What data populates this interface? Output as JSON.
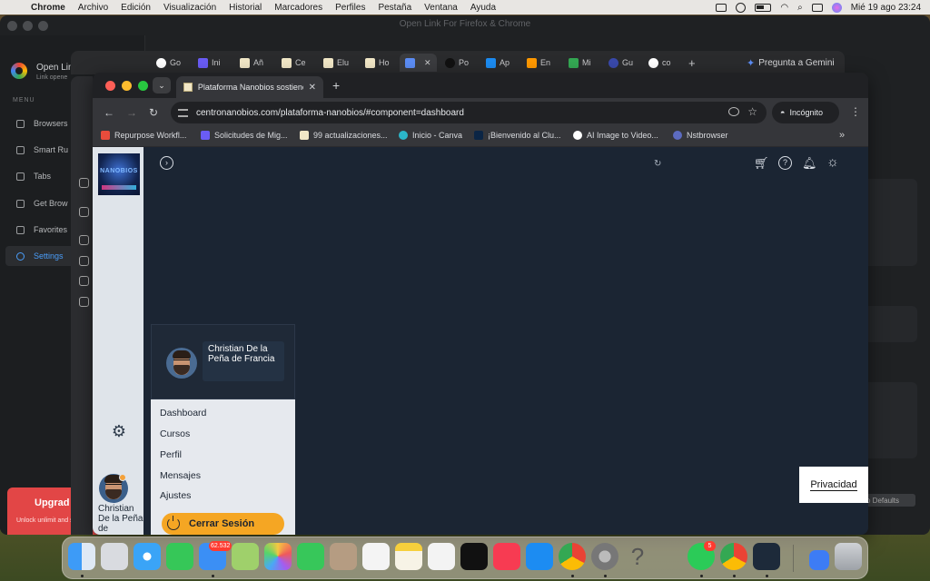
{
  "menubar": {
    "app": "Chrome",
    "items": [
      "Archivo",
      "Edición",
      "Visualización",
      "Historial",
      "Marcadores",
      "Perfiles",
      "Pestaña",
      "Ventana",
      "Ayuda"
    ],
    "datetime": "Mié 19 ago 23:24"
  },
  "bg_app": {
    "window_title": "Open Link For Firefox & Chrome",
    "name": "Open Link For",
    "subtitle": "Link opene",
    "menu_label": "MENU",
    "nav": [
      "Browsers",
      "Smart Ru",
      "Tabs",
      "Get Brow",
      "Favorites",
      "Settings"
    ],
    "upgrade_title": "Upgrad",
    "upgrade_desc": "Unlock unlimit and skip the p",
    "defaults_label": "o Defaults"
  },
  "mid_window": {
    "tabs": [
      "Go",
      "Ini",
      "Añ",
      "Ce",
      "Elu",
      "Ho",
      "",
      "Po",
      "Ap",
      "En",
      "Mi",
      "Gu",
      "co"
    ],
    "gemini_label": "Pregunta a Gemini"
  },
  "browser": {
    "tab_title": "Plataforma Nanobios sostienes",
    "url": "centronanobios.com/plataforma-nanobios/#component=dashboard",
    "incognito_label": "Incógnito",
    "bookmarks": [
      "Repurpose Workfl...",
      "Solicitudes de Mig...",
      "99 actualizaciones...",
      "Inicio - Canva",
      "¡Bienvenido al Clu...",
      "AI Image to Video...",
      "Nstbrowser"
    ]
  },
  "app": {
    "logo_text": "NANOBIOS",
    "user_name": "Christian De la Peña de Francia",
    "sidebar_name": "Christian De la Peña de",
    "menu_items": [
      "Dashboard",
      "Cursos",
      "Perfil",
      "Mensajes",
      "Ajustes"
    ],
    "logout_label": "Cerrar Sesión",
    "privacy_label": "Privacidad"
  },
  "dock": {
    "mail_badge": "62.532",
    "whatsapp_badge": "5"
  },
  "colors": {
    "page_bg": "#1b2533",
    "sidebar_bg": "#dfe4ea",
    "logout_bg": "#f5a623",
    "settings_accent": "#4a9df8",
    "upgrade_bg": "#e24646"
  }
}
